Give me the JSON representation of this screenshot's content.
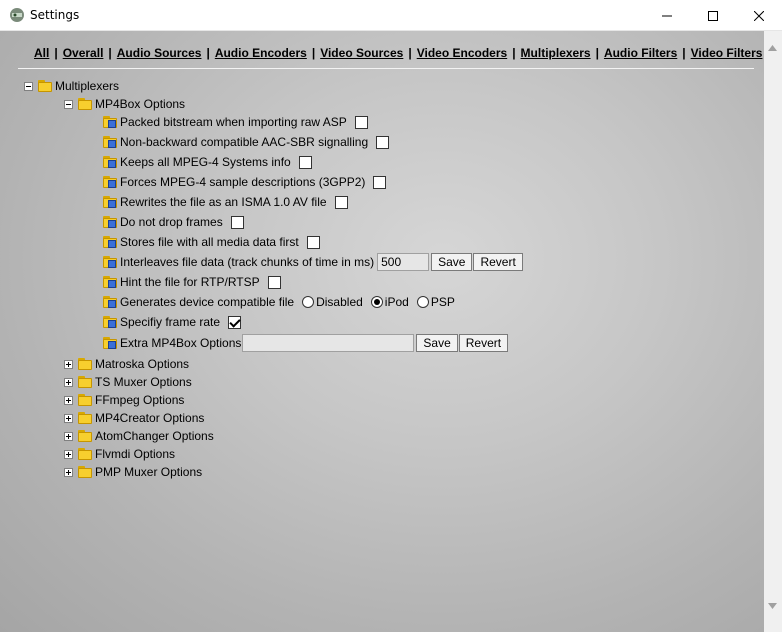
{
  "window": {
    "title": "Settings"
  },
  "nav": [
    "All",
    "Overall",
    "Audio Sources",
    "Audio Encoders",
    "Video Sources",
    "Video Encoders",
    "Multiplexers",
    "Audio Filters",
    "Video Filters"
  ],
  "tree": {
    "root": "Multiplexers",
    "group": "MP4Box Options",
    "options": {
      "packed": {
        "label": "Packed bitstream when importing raw ASP",
        "checked": false
      },
      "nonbackward": {
        "label": "Non-backward compatible AAC-SBR signalling",
        "checked": false
      },
      "keepall": {
        "label": "Keeps all MPEG-4 Systems info",
        "checked": false
      },
      "forces": {
        "label": "Forces MPEG-4 sample descriptions (3GPP2)",
        "checked": false
      },
      "rewrites": {
        "label": "Rewrites the file as an ISMA 1.0 AV file",
        "checked": false
      },
      "nodrop": {
        "label": "Do not drop frames",
        "checked": false
      },
      "stores": {
        "label": "Stores file with all media data first",
        "checked": false
      },
      "interleave": {
        "label": "Interleaves file data (track chunks of time in ms)",
        "value": "500"
      },
      "hint": {
        "label": "Hint the file for RTP/RTSP",
        "checked": false
      },
      "device": {
        "label": "Generates device compatible file",
        "choices": [
          "Disabled",
          "iPod",
          "PSP"
        ],
        "selected": "iPod"
      },
      "framerate": {
        "label": "Specifiy frame rate",
        "checked": true
      },
      "extra": {
        "label": "Extra MP4Box Options",
        "value": ""
      }
    },
    "buttons": {
      "save": "Save",
      "revert": "Revert"
    },
    "collapsed": [
      "Matroska Options",
      "TS Muxer Options",
      "FFmpeg Options",
      "MP4Creator Options",
      "AtomChanger Options",
      "Flvmdi Options",
      "PMP Muxer Options"
    ]
  }
}
